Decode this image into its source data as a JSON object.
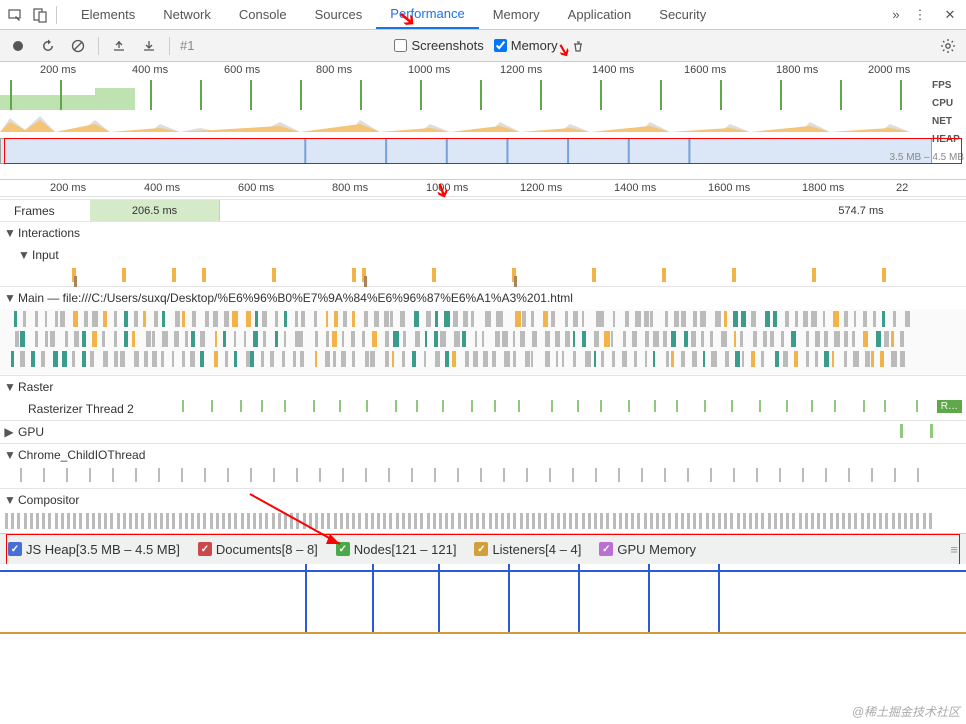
{
  "tabs": {
    "items": [
      "Elements",
      "Network",
      "Console",
      "Sources",
      "Performance",
      "Memory",
      "Application",
      "Security"
    ],
    "active": "Performance"
  },
  "toolbar": {
    "recording_id": "#1",
    "screenshots_label": "Screenshots",
    "memory_label": "Memory",
    "screenshots_checked": false,
    "memory_checked": true
  },
  "overview": {
    "ticks": [
      "200 ms",
      "400 ms",
      "600 ms",
      "800 ms",
      "1000 ms",
      "1200 ms",
      "1400 ms",
      "1600 ms",
      "1800 ms",
      "2000 ms"
    ],
    "side_labels": [
      "FPS",
      "CPU",
      "NET",
      "HEAP"
    ],
    "heap_range": "3.5 MB – 4.5 MB"
  },
  "flame_ruler": [
    "200 ms",
    "400 ms",
    "600 ms",
    "800 ms",
    "1000 ms",
    "1200 ms",
    "1400 ms",
    "1600 ms",
    "1800 ms",
    "22"
  ],
  "tracks": {
    "frames_label": "Frames",
    "frame_times": [
      "206.5 ms",
      "574.7 ms"
    ],
    "interactions": "Interactions",
    "input": "Input",
    "main": "Main — file:///C:/Users/suxq/Desktop/%E6%96%B0%E7%9A%84%E6%96%87%E6%A1%A3%201.html",
    "raster": "Raster",
    "raster_thread": "Rasterizer Thread 2",
    "raster_badge": "R…",
    "gpu": "GPU",
    "child_io": "Chrome_ChildIOThread",
    "compositor": "Compositor"
  },
  "legend": {
    "items": [
      {
        "label": "JS Heap[3.5 MB – 4.5 MB]",
        "color": "#4a6fd4",
        "checked": true
      },
      {
        "label": "Documents[8 – 8]",
        "color": "#c94a4a",
        "checked": true
      },
      {
        "label": "Nodes[121 – 121]",
        "color": "#4aa94a",
        "checked": true
      },
      {
        "label": "Listeners[4 – 4]",
        "color": "#d2a03a",
        "checked": true
      },
      {
        "label": "GPU Memory",
        "color": "#b96fd4",
        "checked": true
      }
    ]
  },
  "watermark": "@稀土掘金技术社区"
}
